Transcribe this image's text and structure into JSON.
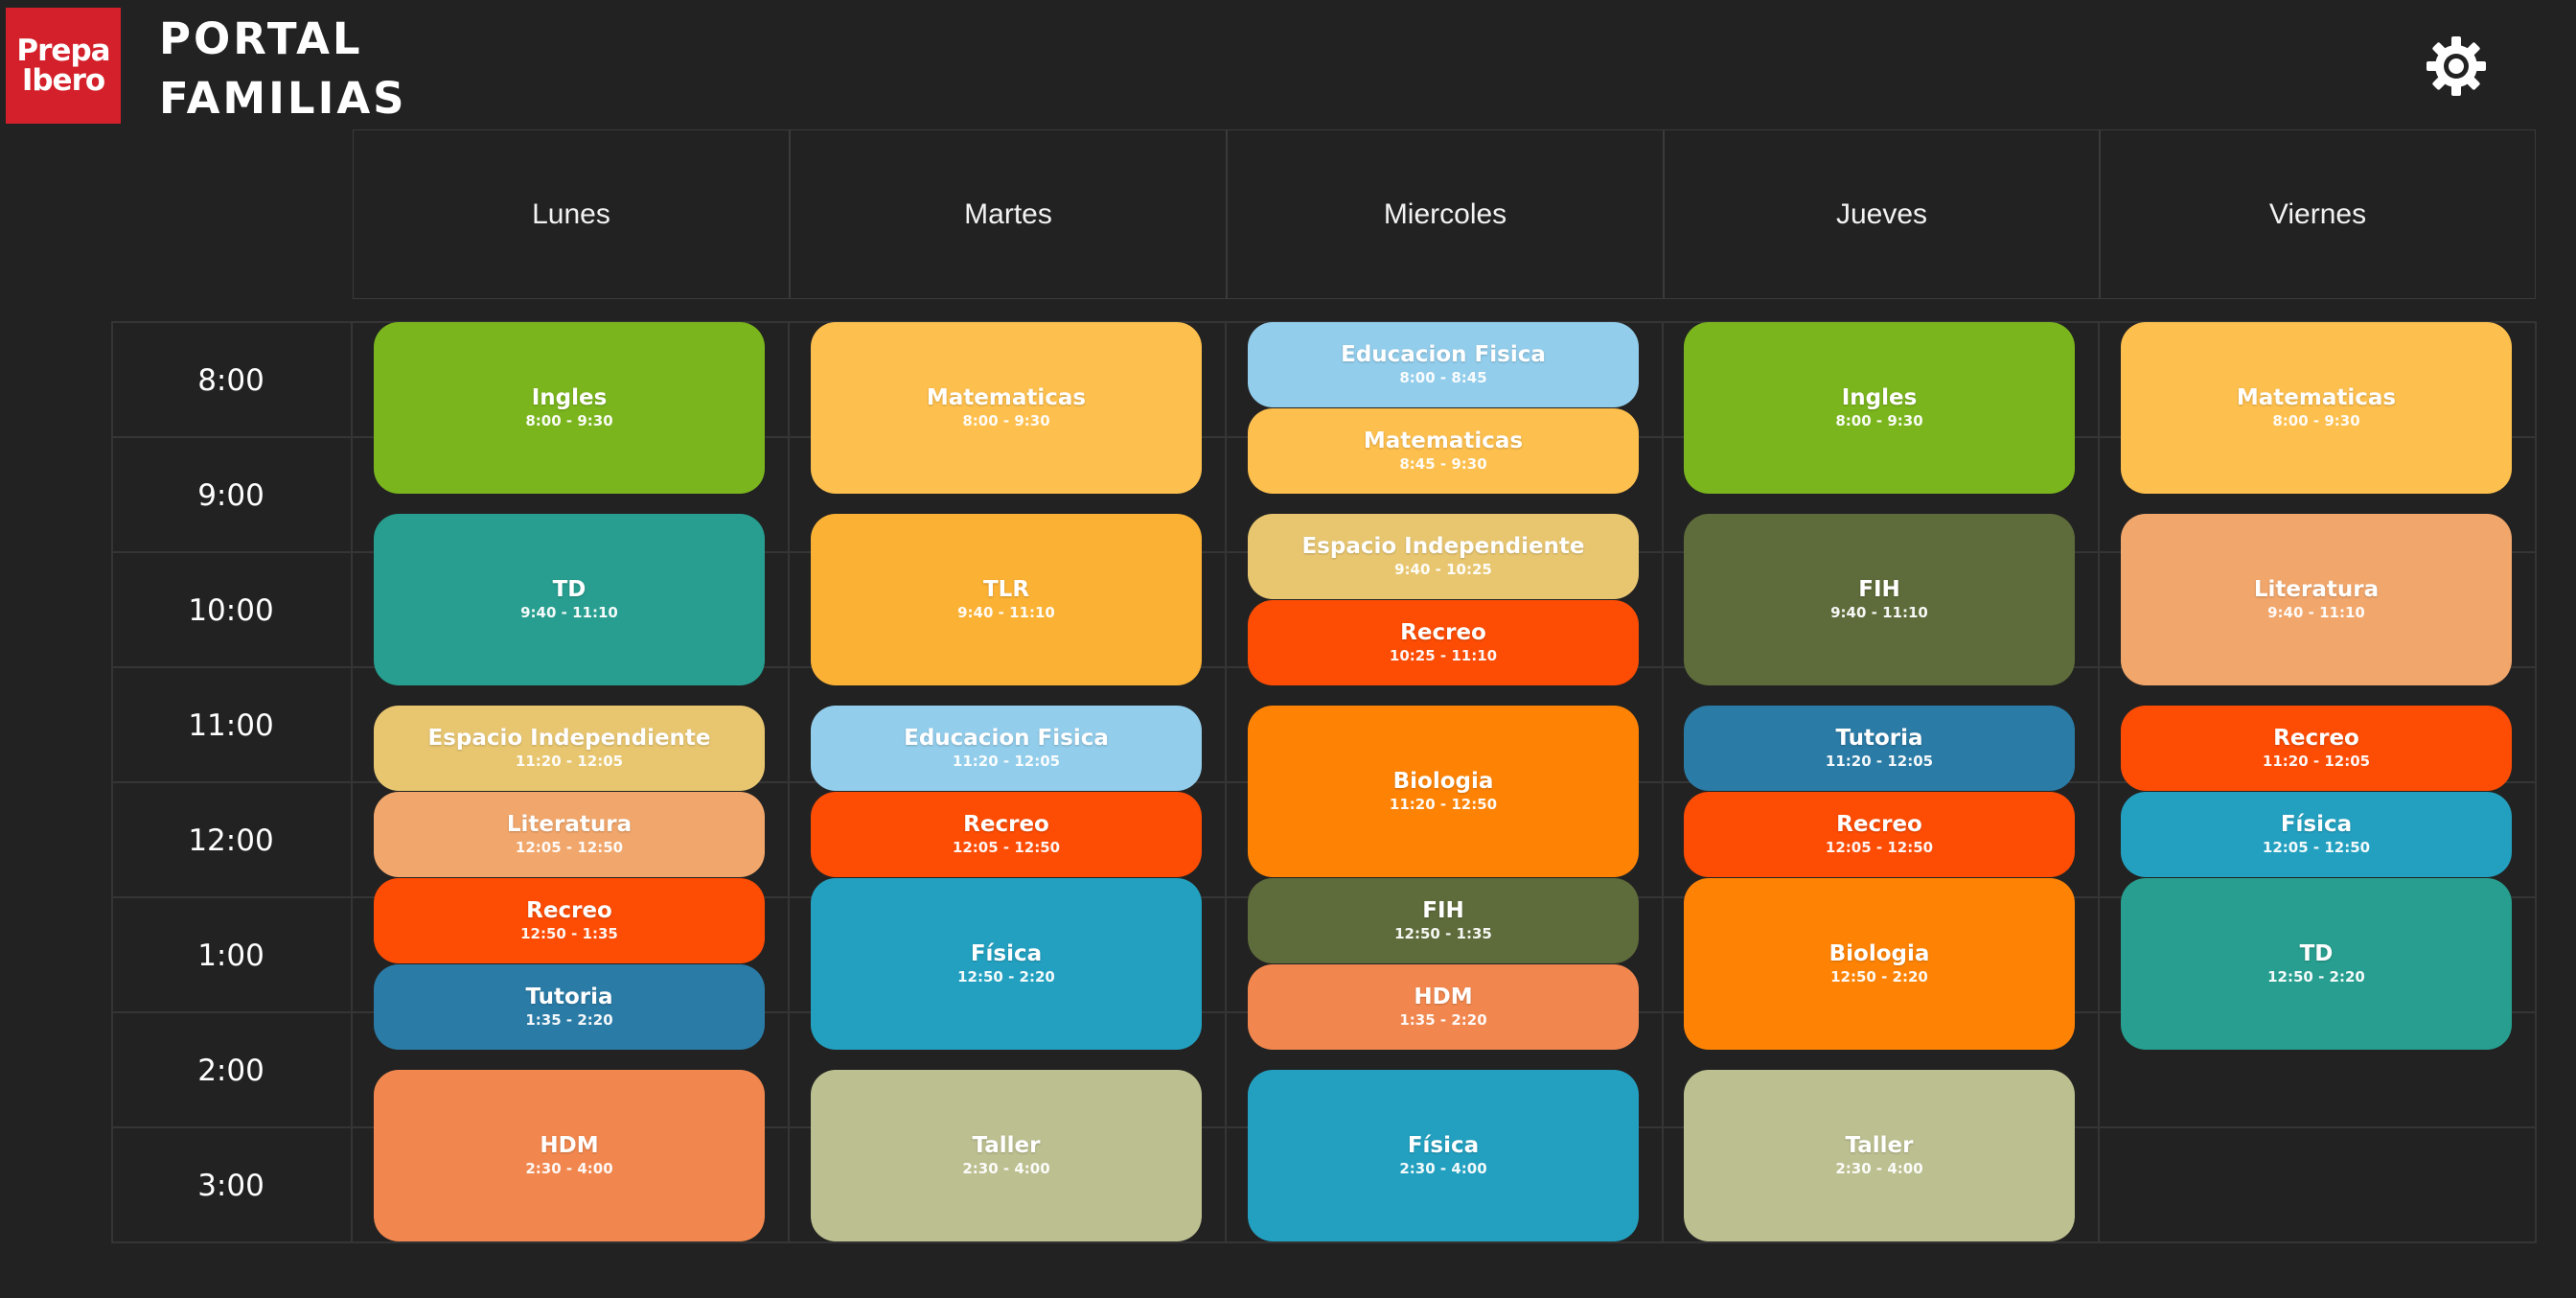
{
  "header": {
    "logo_line1": "Prepa",
    "logo_line2": "Ibero",
    "title_line1": "Portal",
    "title_line2": "Familias",
    "settings_icon": "gear-icon"
  },
  "days": [
    "Lunes",
    "Martes",
    "Miercoles",
    "Jueves",
    "Viernes"
  ],
  "times": [
    "8:00",
    "9:00",
    "10:00",
    "11:00",
    "12:00",
    "1:00",
    "2:00",
    "3:00"
  ],
  "colors": {
    "ingles": "#7ab51d",
    "matematicas": "#fdbf4d",
    "td": "#279e8f",
    "tlr": "#fbb134",
    "espacio": "#e8c670",
    "literatura": "#f1a66b",
    "recreo": "#fd4c04",
    "tutoria": "#2a7ba6",
    "hdm": "#f1874e",
    "taller": "#bcbf8f",
    "educacion_fisica": "#92cdeb",
    "fisica": "#23a0c0",
    "biologia": "#fe8304",
    "fih": "#5e6b3a",
    "brand_red": "#d4202a",
    "background": "#222222"
  },
  "schedule": {
    "lunes": [
      {
        "title": "Ingles",
        "time": "8:00 - 9:30",
        "color_key": "ingles"
      },
      {
        "title": "TD",
        "time": "9:40 - 11:10",
        "color_key": "td"
      },
      {
        "title": "Espacio Independiente",
        "time": "11:20 - 12:05",
        "color_key": "espacio"
      },
      {
        "title": "Literatura",
        "time": "12:05 - 12:50",
        "color_key": "literatura"
      },
      {
        "title": "Recreo",
        "time": "12:50 - 1:35",
        "color_key": "recreo"
      },
      {
        "title": "Tutoria",
        "time": "1:35 - 2:20",
        "color_key": "tutoria"
      },
      {
        "title": "HDM",
        "time": "2:30 - 4:00",
        "color_key": "hdm"
      }
    ],
    "martes": [
      {
        "title": "Matematicas",
        "time": "8:00 - 9:30",
        "color_key": "matematicas"
      },
      {
        "title": "TLR",
        "time": "9:40 - 11:10",
        "color_key": "tlr"
      },
      {
        "title": "Educacion Fisica",
        "time": "11:20 - 12:05",
        "color_key": "educacion_fisica"
      },
      {
        "title": "Recreo",
        "time": "12:05 - 12:50",
        "color_key": "recreo"
      },
      {
        "title": "Física",
        "time": "12:50 - 2:20",
        "color_key": "fisica"
      },
      {
        "title": "Taller",
        "time": "2:30 - 4:00",
        "color_key": "taller"
      }
    ],
    "miercoles": [
      {
        "title": "Educacion Fisica",
        "time": "8:00 - 8:45",
        "color_key": "educacion_fisica"
      },
      {
        "title": "Matematicas",
        "time": "8:45 - 9:30",
        "color_key": "matematicas"
      },
      {
        "title": "Espacio Independiente",
        "time": "9:40 - 10:25",
        "color_key": "espacio"
      },
      {
        "title": "Recreo",
        "time": "10:25 - 11:10",
        "color_key": "recreo"
      },
      {
        "title": "Biologia",
        "time": "11:20 - 12:50",
        "color_key": "biologia"
      },
      {
        "title": "FIH",
        "time": "12:50 - 1:35",
        "color_key": "fih"
      },
      {
        "title": "HDM",
        "time": "1:35 - 2:20",
        "color_key": "hdm"
      },
      {
        "title": "Física",
        "time": "2:30 - 4:00",
        "color_key": "fisica"
      }
    ],
    "jueves": [
      {
        "title": "Ingles",
        "time": "8:00 - 9:30",
        "color_key": "ingles"
      },
      {
        "title": "FIH",
        "time": "9:40 - 11:10",
        "color_key": "fih"
      },
      {
        "title": "Tutoria",
        "time": "11:20 - 12:05",
        "color_key": "tutoria"
      },
      {
        "title": "Recreo",
        "time": "12:05 - 12:50",
        "color_key": "recreo"
      },
      {
        "title": "Biologia",
        "time": "12:50 - 2:20",
        "color_key": "biologia"
      },
      {
        "title": "Taller",
        "time": "2:30 - 4:00",
        "color_key": "taller"
      }
    ],
    "viernes": [
      {
        "title": "Matematicas",
        "time": "8:00 - 9:30",
        "color_key": "matematicas"
      },
      {
        "title": "Literatura",
        "time": "9:40 - 11:10",
        "color_key": "literatura"
      },
      {
        "title": "Recreo",
        "time": "11:20 - 12:05",
        "color_key": "recreo"
      },
      {
        "title": "Física",
        "time": "12:05 - 12:50",
        "color_key": "fisica"
      },
      {
        "title": "TD",
        "time": "12:50 - 2:20",
        "color_key": "td"
      }
    ]
  }
}
